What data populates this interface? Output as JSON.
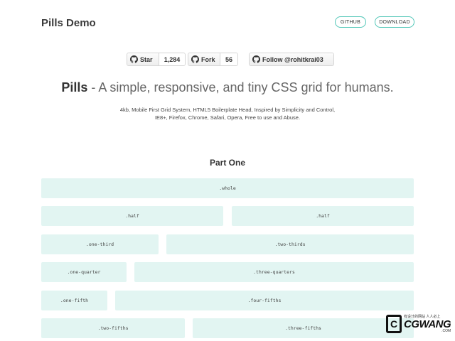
{
  "header": {
    "brand": "Pills Demo",
    "nav": {
      "github": "GITHUB",
      "download": "DOWNLOAD"
    },
    "accent_color": "#52c7b8"
  },
  "github_buttons": {
    "star": {
      "label": "Star",
      "count": "1,284",
      "icon": "github-icon"
    },
    "fork": {
      "label": "Fork",
      "count": "56",
      "icon": "github-icon"
    },
    "follow": {
      "label": "Follow @rohitkrai03",
      "icon": "github-icon"
    }
  },
  "hero": {
    "brand": "Pills",
    "tagline": " - A simple, responsive, and tiny CSS grid for humans.",
    "description_line1": "4kb, Mobile First Grid System, HTML5 Boilerplate Head, Inspired by Simplicity and Control,",
    "description_line2": "IE8+, Firefox, Chrome, Safari, Opera, Free to use and Abuse."
  },
  "section": {
    "title": "Part One",
    "cell_color": "#e2f5f2",
    "rows": [
      [
        ".whole"
      ],
      [
        ".half",
        ".half"
      ],
      [
        ".one-third",
        ".two-thirds"
      ],
      [
        ".one-quarter",
        ".three-quarters"
      ],
      [
        ".one-fifth",
        ".four-fifths"
      ],
      [
        ".two-fifths",
        ".three-fifths"
      ]
    ]
  },
  "watermark": {
    "mark": "C",
    "small": "有设计的网站 人人必上",
    "name": "CGWANG",
    "suffix": ".COM"
  }
}
